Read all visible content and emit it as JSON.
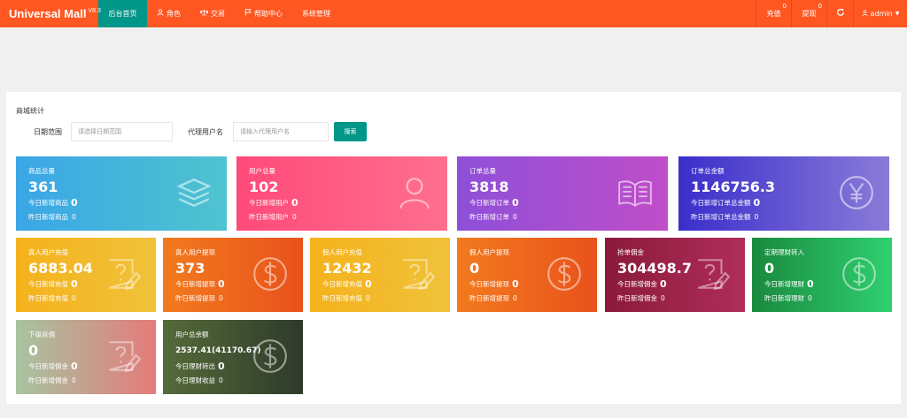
{
  "header": {
    "brand": "Universal Mall",
    "version": "V8.3",
    "nav": [
      {
        "label": "后台首页",
        "icon": "",
        "active": true
      },
      {
        "label": "角色",
        "icon": "user-icon"
      },
      {
        "label": "交易",
        "icon": "scale-icon"
      },
      {
        "label": "帮助中心",
        "icon": "flag-icon"
      },
      {
        "label": "系统管理",
        "icon": ""
      }
    ],
    "recharge": {
      "label": "充值",
      "count": "0"
    },
    "withdraw": {
      "label": "提现",
      "count": "0"
    },
    "refresh_icon": "refresh-icon",
    "user": {
      "label": "admin",
      "icon": "user-icon"
    }
  },
  "panel": {
    "title": "商城统计",
    "date_label": "日期范围",
    "date_placeholder": "请选择日期范围",
    "agent_label": "代理用户名",
    "agent_placeholder": "请输入代理用户名",
    "search_label": "搜索"
  },
  "cards": [
    {
      "title": "商品总量",
      "value": "361",
      "line1_label": "今日新增商品",
      "line1_value": "0",
      "line2_label": "昨日新增商品",
      "line2_value": "0",
      "icon": "layers-icon",
      "gradient": [
        "#3aa6e6",
        "#4fc3d0"
      ]
    },
    {
      "title": "用户总量",
      "value": "102",
      "line1_label": "今日新增用户",
      "line1_value": "0",
      "line2_label": "昨日新增用户",
      "line2_value": "0",
      "icon": "user-icon",
      "gradient": [
        "#ff4a7a",
        "#ff6f8e"
      ]
    },
    {
      "title": "订单总量",
      "value": "3818",
      "line1_label": "今日新增订单",
      "line1_value": "0",
      "line2_label": "昨日新增订单",
      "line2_value": "0",
      "icon": "book-icon",
      "gradient": [
        "#8e4fd8",
        "#c04ec9"
      ]
    },
    {
      "title": "订单总金额",
      "value": "1146756.3",
      "line1_label": "今日新增订单总金额",
      "line1_value": "0",
      "line2_label": "昨日新增订单总金额",
      "line2_value": "0",
      "icon": "yen-icon",
      "gradient": [
        "#3a2ecb",
        "#8a7bd8"
      ]
    },
    {
      "title": "真人用户充值",
      "value": "6883.04",
      "line1_label": "今日新增充值",
      "line1_value": "0",
      "line2_label": "昨日新增充值",
      "line2_value": "0",
      "icon": "question-edit-icon",
      "gradient": [
        "#f5b21c",
        "#f0c23a"
      ]
    },
    {
      "title": "真人用户提现",
      "value": "373",
      "line1_label": "今日新增提现",
      "line1_value": "0",
      "line2_label": "昨日新增提现",
      "line2_value": "0",
      "icon": "dollar-icon",
      "gradient": [
        "#f27a1e",
        "#e9521c"
      ]
    },
    {
      "title": "假人用户充值",
      "value": "12432",
      "line1_label": "今日新增充值",
      "line1_value": "0",
      "line2_label": "昨日新增充值",
      "line2_value": "0",
      "icon": "question-edit-icon",
      "gradient": [
        "#f5b21c",
        "#f0c23a"
      ]
    },
    {
      "title": "假人用户提现",
      "value": "0",
      "line1_label": "今日新增提现",
      "line1_value": "0",
      "line2_label": "昨日新增提现",
      "line2_value": "0",
      "icon": "dollar-icon",
      "gradient": [
        "#f27a1e",
        "#e9521c"
      ]
    },
    {
      "title": "抢单佣金",
      "value": "304498.7",
      "line1_label": "今日新增佣金",
      "line1_value": "0",
      "line2_label": "昨日新增佣金",
      "line2_value": "0",
      "icon": "question-edit-icon",
      "gradient": [
        "#8a1a3a",
        "#b02d5a"
      ]
    },
    {
      "title": "定期理财转入",
      "value": "0",
      "line1_label": "今日新增理财",
      "line1_value": "0",
      "line2_label": "昨日新增理财",
      "line2_value": "0",
      "icon": "dollar-icon",
      "gradient": [
        "#1a8a3e",
        "#2fd070"
      ]
    },
    {
      "title": "下级返佣",
      "value": "0",
      "line1_label": "今日新增佣金",
      "line1_value": "0",
      "line2_label": "昨日新增佣金",
      "line2_value": "0",
      "icon": "question-edit-icon",
      "gradient": [
        "#a6c4a0",
        "#e47b7b"
      ]
    },
    {
      "title": "用户总余额",
      "value": "2537.41(41170.67)",
      "line1_label": "今日理财转出",
      "line1_value": "0",
      "line2_label": "今日理财收益",
      "line2_value": "0",
      "icon": "dollar-icon",
      "gradient": [
        "#556b3a",
        "#2e3a2a"
      ]
    }
  ]
}
